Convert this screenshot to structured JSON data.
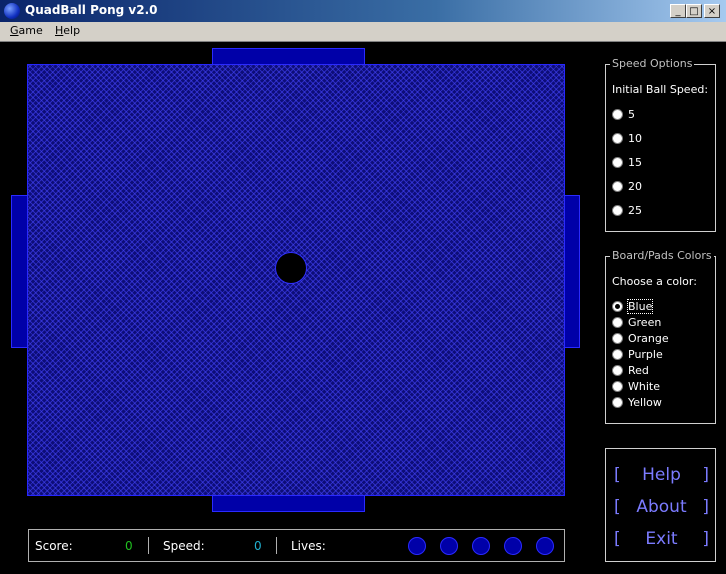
{
  "window": {
    "title": "QuadBall Pong v2.0",
    "min_glyph": "_",
    "max_glyph": "□",
    "close_glyph": "×"
  },
  "menu": {
    "items": [
      "Game",
      "Help"
    ]
  },
  "game": {
    "board_color": "#0d0d78",
    "pad_color": "#0000a8"
  },
  "status": {
    "score_label": "Score:",
    "score_value": "0",
    "speed_label": "Speed:",
    "speed_value": "0",
    "lives_label": "Lives:",
    "lives_count": 5
  },
  "speed_options": {
    "title": "Speed Options",
    "label": "Initial Ball Speed:",
    "options": [
      "5",
      "10",
      "15",
      "20",
      "25"
    ],
    "selected": null
  },
  "color_options": {
    "title": "Board/Pads Colors",
    "label": "Choose a color:",
    "options": [
      "Blue",
      "Green",
      "Orange",
      "Purple",
      "Red",
      "White",
      "Yellow"
    ],
    "selected": "Blue"
  },
  "nav": {
    "left_bracket": "[",
    "right_bracket": "]",
    "help": "Help",
    "about": "About",
    "exit": "Exit"
  }
}
